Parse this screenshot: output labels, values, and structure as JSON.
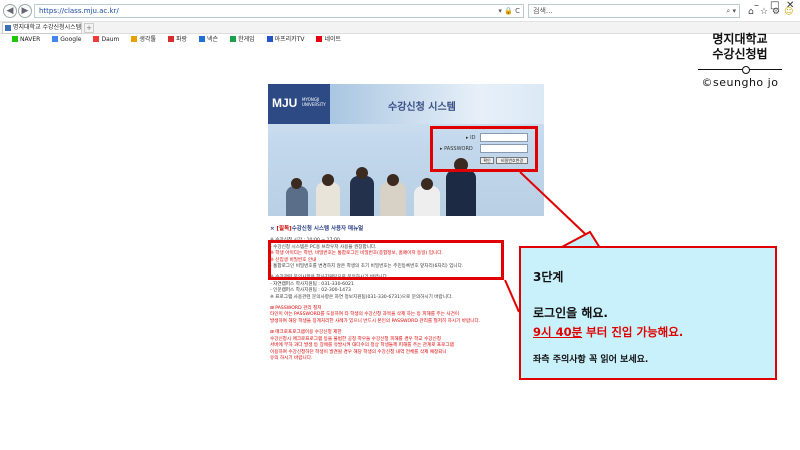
{
  "browser": {
    "url": "https://class.mju.ac.kr/",
    "address_controls": "▾ 🔒 C",
    "search_placeholder": "검색...",
    "search_controls": "⌕ ▾",
    "tab_title": "명지대학교 수강신청시스템",
    "window_buttons": [
      "–",
      "□",
      "✕"
    ],
    "toolbar_icons": [
      "home-icon",
      "star-icon",
      "gear-icon",
      "smiley-icon"
    ],
    "favorites": [
      {
        "label": "NAVER",
        "color": "#1ec800"
      },
      {
        "label": "Google",
        "color": "#4285f4"
      },
      {
        "label": "Daum",
        "color": "#ee3b3b"
      },
      {
        "label": "생각툴",
        "color": "#e6a200"
      },
      {
        "label": "파랑",
        "color": "#d92d2d"
      },
      {
        "label": "넥슨",
        "color": "#1f6fd6"
      },
      {
        "label": "한게임",
        "color": "#1aa34a"
      },
      {
        "label": "아프리카TV",
        "color": "#2355c8"
      },
      {
        "label": "네이트",
        "color": "#e60012"
      }
    ]
  },
  "author": {
    "title_line1": "명지대학교",
    "title_line2": "수강신청법",
    "copyright": "©seungho jo"
  },
  "banner": {
    "logo": "MJU",
    "logo_sub": "MYONGJI UNIVERSITY",
    "system_title": "수강신청 시스템",
    "id_label": "ID",
    "password_label": "PASSWORD",
    "confirm_button": "확인",
    "change_pw_button": "비밀번호변경"
  },
  "notice": {
    "heading_tag": "[필독]",
    "heading": "수강신청 시스템 사용자 매뉴얼",
    "items": [
      {
        "text": "※ 수강신청 시간 : 10:00 ~ 17:00",
        "red": false
      },
      {
        "text": "- 수강신청 시스템은 PC용 브라우저 사용을 권장합니다.",
        "red": false
      },
      {
        "text": "※ 학생 아이디는 학번, 비밀번호는 통합로그인 비밀번호(종합정보, 홈페이지 동일) 입니다.",
        "red": true
      },
      {
        "text": "※ 신입생 비밀번호 안내",
        "red": true
      },
      {
        "text": "- 통합로그인 비밀번호를 변경하지 않은 학생의 초기 비밀번호는 주민등록번호 앞자리(6자리) 입니다.",
        "red": false
      },
      {
        "text": "※ 수강관련 문의사항은 학사지원팀으로 문의하시기 바랍니다.",
        "red": false
      },
      {
        "text": "- 자연캠퍼스 학사지원팀 : 031-330-6021",
        "red": false
      },
      {
        "text": "- 인문캠퍼스 학사지원팀 : 02-300-1473",
        "red": false
      },
      {
        "text": "※ 프로그램 사용관련 문의사항은 자연 정보지원팀(031-330-6731)으로 문의하시기 바랍니다.",
        "red": false
      },
      {
        "text": "⊞ PASSWORD 관리 철저",
        "red": true
      },
      {
        "text": "타인이 아는 PASSWORD를 도용하여 타 학생의 수강신청 과목을 삭제 하는 등 피해를 주는 사건이",
        "red": true
      },
      {
        "text": "발생하여 해당 학생을 징계처리한 사례가 있으니 반드시 본인의 PASSWORD 관리를 철저히 하시기 바랍니다.",
        "red": true
      },
      {
        "text": "⊞ 매크로프로그램이용 수강신청 제한",
        "red": true
      },
      {
        "text": "수강신청시 매크로프로그램 등을 불법한 공정 학우들 수강신청 피해를 경우 학교 수강신청",
        "red": true
      },
      {
        "text": "서버에 부하 과다 발생 등 장애를 유발시켜 대다수의 정상 학생들께 피해를 주는 관계로 프로그램",
        "red": true
      },
      {
        "text": "이용하여 수강신청하던 학생이 발견될 경우 해당 학생의 수강신청 내역 전체를 삭제 예정되니",
        "red": true
      },
      {
        "text": "유의 하시기 바랍니다.",
        "red": true
      }
    ]
  },
  "callout": {
    "step": "3단계",
    "line1": "로그인을 해요.",
    "line2_highlight": "9시 40분",
    "line2_rest": " 부터 진입 가능해요.",
    "line3": "좌측 주의사항 꼭 읽어 보세요.",
    "accent_color": "#e00000",
    "background_color": "#c9f1fb"
  }
}
